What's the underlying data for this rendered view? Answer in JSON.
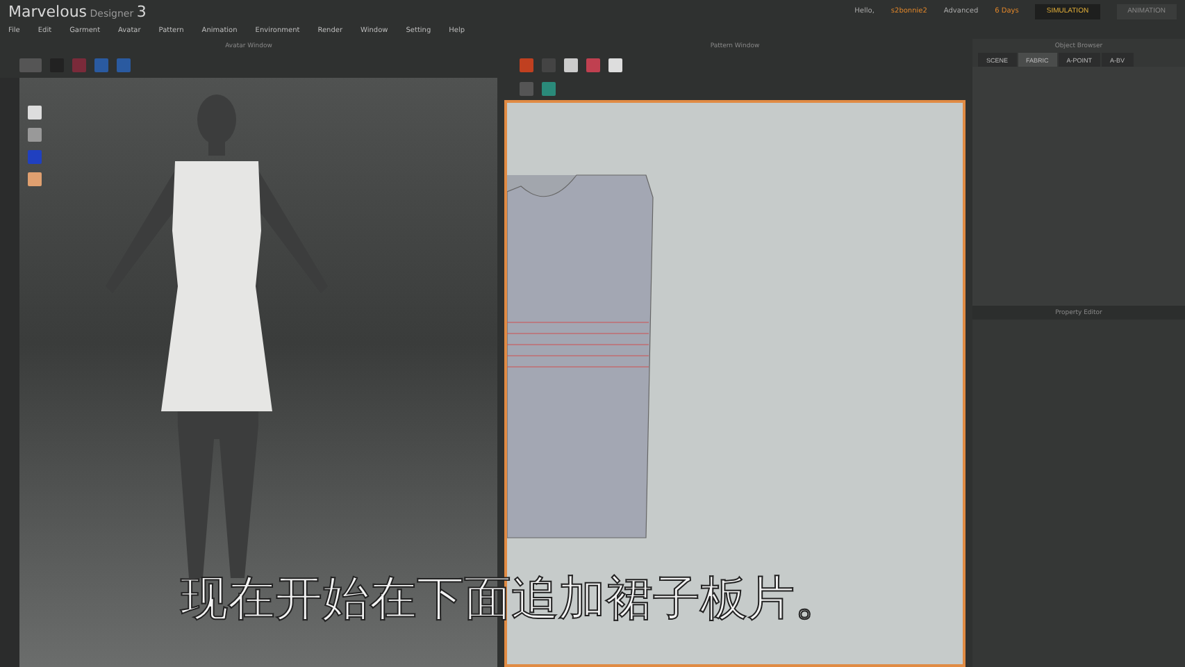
{
  "window": {
    "title": "Marvelous",
    "title_suffix": "Designer",
    "version": "3"
  },
  "menu": [
    "File",
    "Edit",
    "Garment",
    "Avatar",
    "Pattern",
    "Animation",
    "Environment",
    "Render",
    "Window",
    "Setting",
    "Help"
  ],
  "account": {
    "greeting": "Hello,",
    "user": "s2bonnie2",
    "plan": "Advanced",
    "days": "6 Days"
  },
  "modes": [
    {
      "label": "SIMULATION",
      "selected": true
    },
    {
      "label": "ANIMATION",
      "selected": false
    }
  ],
  "avatar_window": {
    "title": "Avatar Window"
  },
  "pattern_window": {
    "title": "Pattern Window"
  },
  "object_browser": {
    "title": "Object Browser",
    "tabs": [
      {
        "label": "SCENE",
        "selected": false
      },
      {
        "label": "FABRIC",
        "selected": true
      },
      {
        "label": "A-POINT",
        "selected": false
      },
      {
        "label": "A-BV",
        "selected": false
      }
    ]
  },
  "property_editor": {
    "title": "Property Editor"
  },
  "subtitle": "现在开始在下面追加裙子板片。"
}
